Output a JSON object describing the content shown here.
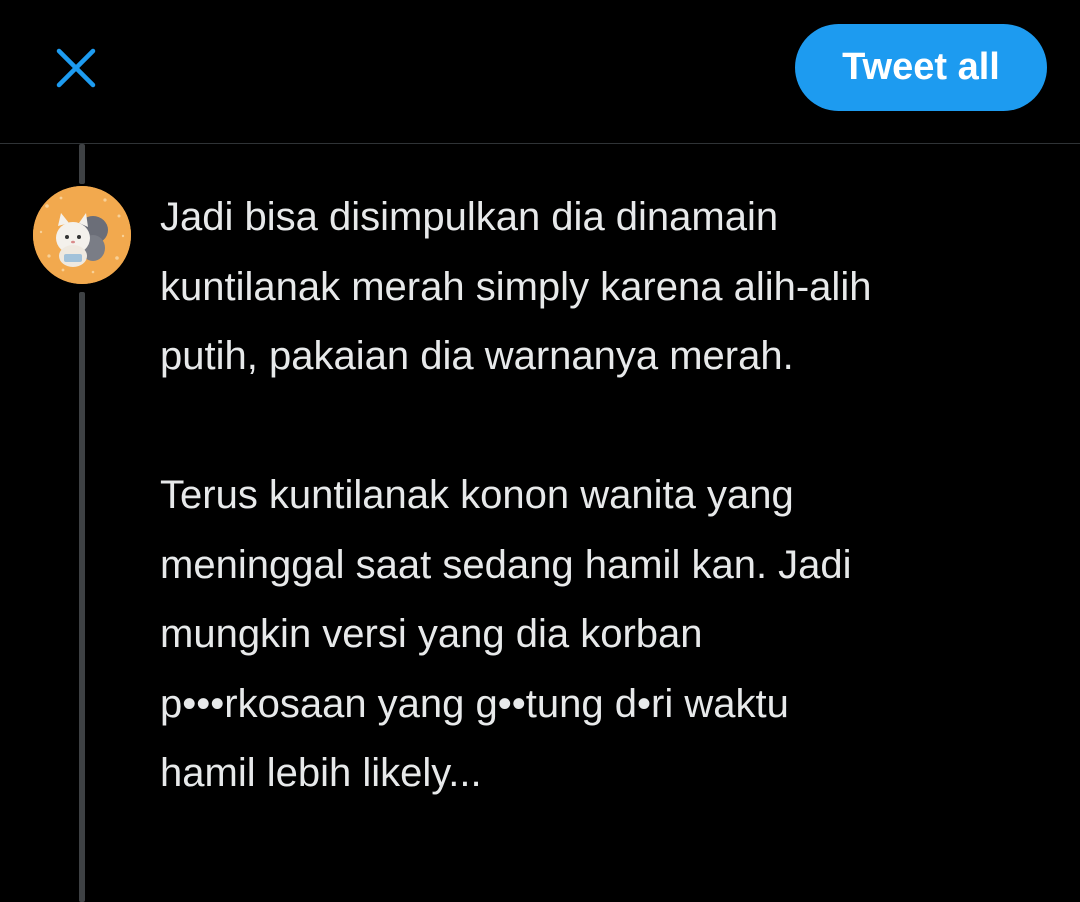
{
  "header": {
    "close_icon": "close-x-icon",
    "tweet_all_label": "Tweet all"
  },
  "colors": {
    "accent": "#1d9bf0",
    "background": "#000000",
    "text": "#e7e9ea",
    "thread_line": "#3e4144",
    "divider": "#2f3336",
    "avatar_bg": "#f2a94e"
  },
  "composer": {
    "avatar_icon": "avatar-cat-icon",
    "paragraphs": [
      "Jadi bisa disimpulkan dia dinamain\nkuntilanak merah simply karena alih-alih\nputih, pakaian dia warnanya merah.",
      "Terus kuntilanak konon wanita yang\nmeninggal saat sedang hamil kan. Jadi\nmungkin versi yang dia korban\np•••rkosaan yang g••tung d•ri waktu\nhamil lebih likely..."
    ]
  }
}
